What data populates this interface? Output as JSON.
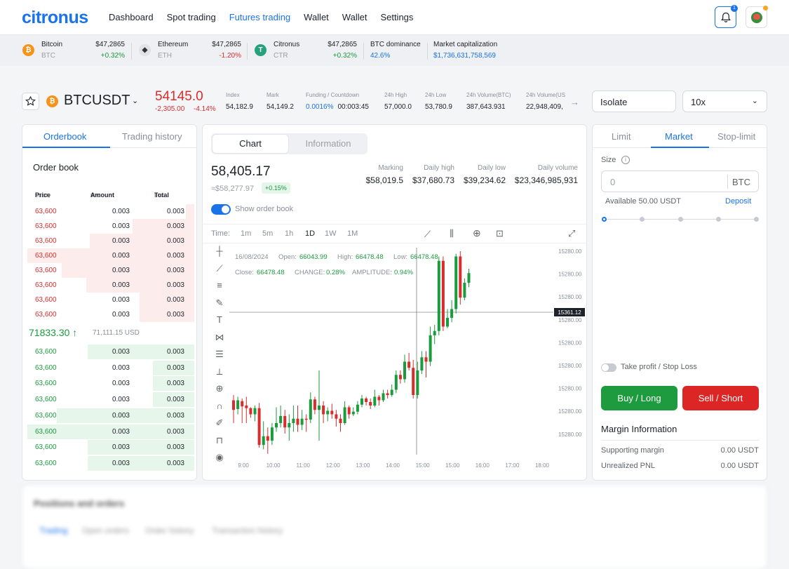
{
  "header": {
    "logo": "citronus",
    "nav": [
      "Dashboard",
      "Spot trading",
      "Futures trading",
      "Wallet",
      "Wallet",
      "Settings"
    ],
    "active_nav": "Futures trading",
    "notification_count": "1",
    "accent_color": "#1a73e8"
  },
  "ticker": [
    {
      "name": "Bitcoin",
      "symbol": "BTC",
      "price": "$47,2865",
      "change": "+0.32%",
      "icon": "bitcoin-icon",
      "icon_text": "₿",
      "icon_color": "#f7931a"
    },
    {
      "name": "Ethereum",
      "symbol": "ETH",
      "price": "$47,2865",
      "change": "-1.20%",
      "icon": "ethereum-icon",
      "icon_text": "◆",
      "icon_color": "#dfe2e6"
    },
    {
      "name": "Citronus",
      "symbol": "CTR",
      "price": "$47,2865",
      "change": "+0.32%",
      "icon": "citronus-icon",
      "icon_text": "T",
      "icon_color": "#26a17b"
    }
  ],
  "dominance": {
    "label": "BTC dominance",
    "value": "42.6%"
  },
  "market_cap": {
    "label": "Market capitalization",
    "value": "$1,736,631,758,569"
  },
  "pair": {
    "symbol": "BTCUSDT",
    "last_price": "54145.0",
    "change": "-2,305.00",
    "change_pct": "-4.14%",
    "stats": [
      {
        "label": "Index",
        "value": "54,182.9"
      },
      {
        "label": "Mark",
        "value": "54,149.2"
      },
      {
        "label": "Funding / Countdown",
        "value": "0.0016%",
        "value2": "00:003:45"
      },
      {
        "label": "24h High",
        "value": "57,000.0"
      },
      {
        "label": "24h Low",
        "value": "53,780.9"
      },
      {
        "label": "24h Volume(BTC)",
        "value": "387,643.931"
      },
      {
        "label": "24h Volume(USDT)",
        "value": "22,948,409,"
      }
    ]
  },
  "margin_mode": "Isolate",
  "leverage": "10x",
  "orderbook": {
    "tabs": [
      "Orderbook",
      "Trading history"
    ],
    "title": "Order book",
    "headers": {
      "price": "Price",
      "price_unit": "USDT",
      "amount": "Amount",
      "amount_unit": "BTC",
      "total": "Total",
      "total_unit": "BTC"
    },
    "asks": [
      {
        "price": "63,600",
        "amount": "0.003",
        "total": "0.003",
        "depth": 0.05
      },
      {
        "price": "63,600",
        "amount": "0.003",
        "total": "0.003",
        "depth": 0.36
      },
      {
        "price": "63,600",
        "amount": "0.003",
        "total": "0.003",
        "depth": 0.61
      },
      {
        "price": "63,600",
        "amount": "0.003",
        "total": "0.003",
        "depth": 0.97
      },
      {
        "price": "63,600",
        "amount": "0.003",
        "total": "0.003",
        "depth": 0.77
      },
      {
        "price": "63,600",
        "amount": "0.003",
        "total": "0.003",
        "depth": 0.63
      },
      {
        "price": "63,600",
        "amount": "0.003",
        "total": "0.003",
        "depth": 0.32
      },
      {
        "price": "63,600",
        "amount": "0.003",
        "total": "0.003",
        "depth": 0.32
      }
    ],
    "mid_price": "71833.30",
    "mid_usd": "71,111.15 USD",
    "bids": [
      {
        "price": "63,600",
        "amount": "0.003",
        "total": "0.003",
        "depth": 0.62
      },
      {
        "price": "63,600",
        "amount": "0.003",
        "total": "0.003",
        "depth": 0.24
      },
      {
        "price": "63,600",
        "amount": "0.003",
        "total": "0.003",
        "depth": 0.24
      },
      {
        "price": "63,600",
        "amount": "0.003",
        "total": "0.003",
        "depth": 0.24
      },
      {
        "price": "63,600",
        "amount": "0.003",
        "total": "0.003",
        "depth": 0.8
      },
      {
        "price": "63,600",
        "amount": "0.003",
        "total": "0.003",
        "depth": 0.97
      },
      {
        "price": "63,600",
        "amount": "0.003",
        "total": "0.003",
        "depth": 0.62
      },
      {
        "price": "63,600",
        "amount": "0.003",
        "total": "0.003",
        "depth": 0.62
      }
    ]
  },
  "chart_panel": {
    "tabs": [
      "Chart",
      "Information"
    ],
    "price": "58,405.17",
    "approx": "≈$58,277.97",
    "change": "+0.15%",
    "metrics": [
      {
        "label": "Marking",
        "value": "$58,019.5"
      },
      {
        "label": "Daily high",
        "value": "$37,680.73"
      },
      {
        "label": "Daily low",
        "value": "$39,234.62"
      },
      {
        "label": "Daily volume",
        "value": "$23,346,985,931"
      }
    ],
    "show_orderbook": "Show order book",
    "time_label": "Time:",
    "intervals": [
      "1m",
      "5m",
      "1h",
      "1D",
      "1W",
      "1M"
    ],
    "active_interval": "1D"
  },
  "chart_data": {
    "type": "candlestick",
    "legend": {
      "date": "16/08/2024",
      "open_label": "Open:",
      "open": "66043.99",
      "high_label": "High:",
      "high": "66478.48",
      "low_label": "Low:",
      "low": "66478.48",
      "close_label": "Close:",
      "close": "66478.48",
      "change_label": "CHANGE:",
      "change": "0.28%",
      "amplitude_label": "AMPLITUDE:",
      "amplitude": "0.94%"
    },
    "y_ticks": [
      "15280.00",
      "15280.00",
      "15280.00",
      "15280.00",
      "15280.00",
      "15280.00",
      "15280.00",
      "15280.00",
      "15280.00"
    ],
    "x_ticks": [
      "9:00",
      "10:00",
      "11:00",
      "12:00",
      "13:00",
      "14:00",
      "15:00",
      "15:00",
      "16:00",
      "17:00",
      "18:00"
    ],
    "crosshair_label": "15361.12",
    "up_color": "#1a9b3c",
    "down_color": "#d92d2d",
    "candles": [
      {
        "o": 15206,
        "c": 15195,
        "h": 15212,
        "l": 15180
      },
      {
        "o": 15196,
        "c": 15206,
        "h": 15210,
        "l": 15190
      },
      {
        "o": 15205,
        "c": 15199,
        "h": 15208,
        "l": 15180
      },
      {
        "o": 15200,
        "c": 15197,
        "h": 15210,
        "l": 15180
      },
      {
        "o": 15197,
        "c": 15190,
        "h": 15198,
        "l": 15186
      },
      {
        "o": 15190,
        "c": 15197,
        "h": 15200,
        "l": 15182
      },
      {
        "o": 15197,
        "c": 15155,
        "h": 15203,
        "l": 15152
      },
      {
        "o": 15155,
        "c": 15165,
        "h": 15182,
        "l": 15150
      },
      {
        "o": 15165,
        "c": 15160,
        "h": 15175,
        "l": 15145
      },
      {
        "o": 15160,
        "c": 15175,
        "h": 15180,
        "l": 15155
      },
      {
        "o": 15175,
        "c": 15180,
        "h": 15198,
        "l": 15170
      },
      {
        "o": 15180,
        "c": 15188,
        "h": 15200,
        "l": 15175
      },
      {
        "o": 15188,
        "c": 15175,
        "h": 15195,
        "l": 15168
      },
      {
        "o": 15175,
        "c": 15180,
        "h": 15190,
        "l": 15160
      },
      {
        "o": 15180,
        "c": 15185,
        "h": 15200,
        "l": 15170
      },
      {
        "o": 15185,
        "c": 15178,
        "h": 15200,
        "l": 15170
      },
      {
        "o": 15178,
        "c": 15185,
        "h": 15195,
        "l": 15172
      },
      {
        "o": 15185,
        "c": 15184,
        "h": 15190,
        "l": 15170
      },
      {
        "o": 15184,
        "c": 15207,
        "h": 15215,
        "l": 15180
      },
      {
        "o": 15207,
        "c": 15195,
        "h": 15210,
        "l": 15190
      },
      {
        "o": 15195,
        "c": 15200,
        "h": 15240,
        "l": 15160
      },
      {
        "o": 15200,
        "c": 15190,
        "h": 15205,
        "l": 15180
      },
      {
        "o": 15190,
        "c": 15194,
        "h": 15198,
        "l": 15182
      },
      {
        "o": 15194,
        "c": 15190,
        "h": 15202,
        "l": 15185
      },
      {
        "o": 15190,
        "c": 15185,
        "h": 15195,
        "l": 15176
      },
      {
        "o": 15185,
        "c": 15180,
        "h": 15190,
        "l": 15170
      },
      {
        "o": 15180,
        "c": 15198,
        "h": 15205,
        "l": 15178
      },
      {
        "o": 15198,
        "c": 15190,
        "h": 15200,
        "l": 15185
      },
      {
        "o": 15190,
        "c": 15193,
        "h": 15198,
        "l": 15188
      },
      {
        "o": 15193,
        "c": 15201,
        "h": 15205,
        "l": 15190
      },
      {
        "o": 15201,
        "c": 15208,
        "h": 15212,
        "l": 15198
      },
      {
        "o": 15208,
        "c": 15204,
        "h": 15210,
        "l": 15200
      },
      {
        "o": 15204,
        "c": 15200,
        "h": 15208,
        "l": 15196
      },
      {
        "o": 15200,
        "c": 15210,
        "h": 15218,
        "l": 15198
      },
      {
        "o": 15210,
        "c": 15206,
        "h": 15212,
        "l": 15200
      },
      {
        "o": 15206,
        "c": 15214,
        "h": 15218,
        "l": 15204
      },
      {
        "o": 15214,
        "c": 15212,
        "h": 15218,
        "l": 15208
      },
      {
        "o": 15212,
        "c": 15218,
        "h": 15224,
        "l": 15210
      },
      {
        "o": 15218,
        "c": 15235,
        "h": 15240,
        "l": 15214
      },
      {
        "o": 15235,
        "c": 15230,
        "h": 15240,
        "l": 15225
      },
      {
        "o": 15230,
        "c": 15250,
        "h": 15258,
        "l": 15226
      },
      {
        "o": 15250,
        "c": 15243,
        "h": 15260,
        "l": 15240
      },
      {
        "o": 15243,
        "c": 15212,
        "h": 15252,
        "l": 15208
      },
      {
        "o": 15212,
        "c": 15240,
        "h": 15250,
        "l": 15208
      },
      {
        "o": 15240,
        "c": 15255,
        "h": 15262,
        "l": 15236
      },
      {
        "o": 15255,
        "c": 15250,
        "h": 15262,
        "l": 15232
      },
      {
        "o": 15250,
        "c": 15280,
        "h": 15290,
        "l": 15245
      },
      {
        "o": 15280,
        "c": 15285,
        "h": 15292,
        "l": 15270
      },
      {
        "o": 15285,
        "c": 15365,
        "h": 15370,
        "l": 15280
      },
      {
        "o": 15365,
        "c": 15290,
        "h": 15370,
        "l": 15285
      },
      {
        "o": 15290,
        "c": 15300,
        "h": 15310,
        "l": 15288
      },
      {
        "o": 15300,
        "c": 15310,
        "h": 15320,
        "l": 15295
      },
      {
        "o": 15310,
        "c": 15370,
        "h": 15373,
        "l": 15305
      },
      {
        "o": 15370,
        "c": 15323,
        "h": 15376,
        "l": 15315
      },
      {
        "o": 15323,
        "c": 15340,
        "h": 15345,
        "l": 15320
      },
      {
        "o": 15340,
        "c": 15351,
        "h": 15356,
        "l": 15335
      }
    ]
  },
  "order_panel": {
    "tabs": [
      "Limit",
      "Market",
      "Stop-limit"
    ],
    "active_tab": "Market",
    "size_label": "Size",
    "size_value": "0",
    "size_unit": "BTC",
    "available": "Available 50.00 USDT",
    "deposit": "Deposit",
    "take_profit": "Take profit / Stop Loss",
    "buy": "Buy / Long",
    "sell": "Sell / Short",
    "margin_title": "Margin Information",
    "margin_rows": [
      {
        "label": "Supporting margin",
        "value": "0.00 USDT"
      },
      {
        "label": "Unrealized PNL",
        "value": "0.00 USDT"
      }
    ]
  },
  "positions": {
    "title": "Positions and orders",
    "tabs": [
      "Trading",
      "Open orders",
      "Order history",
      "Transaction history"
    ]
  }
}
